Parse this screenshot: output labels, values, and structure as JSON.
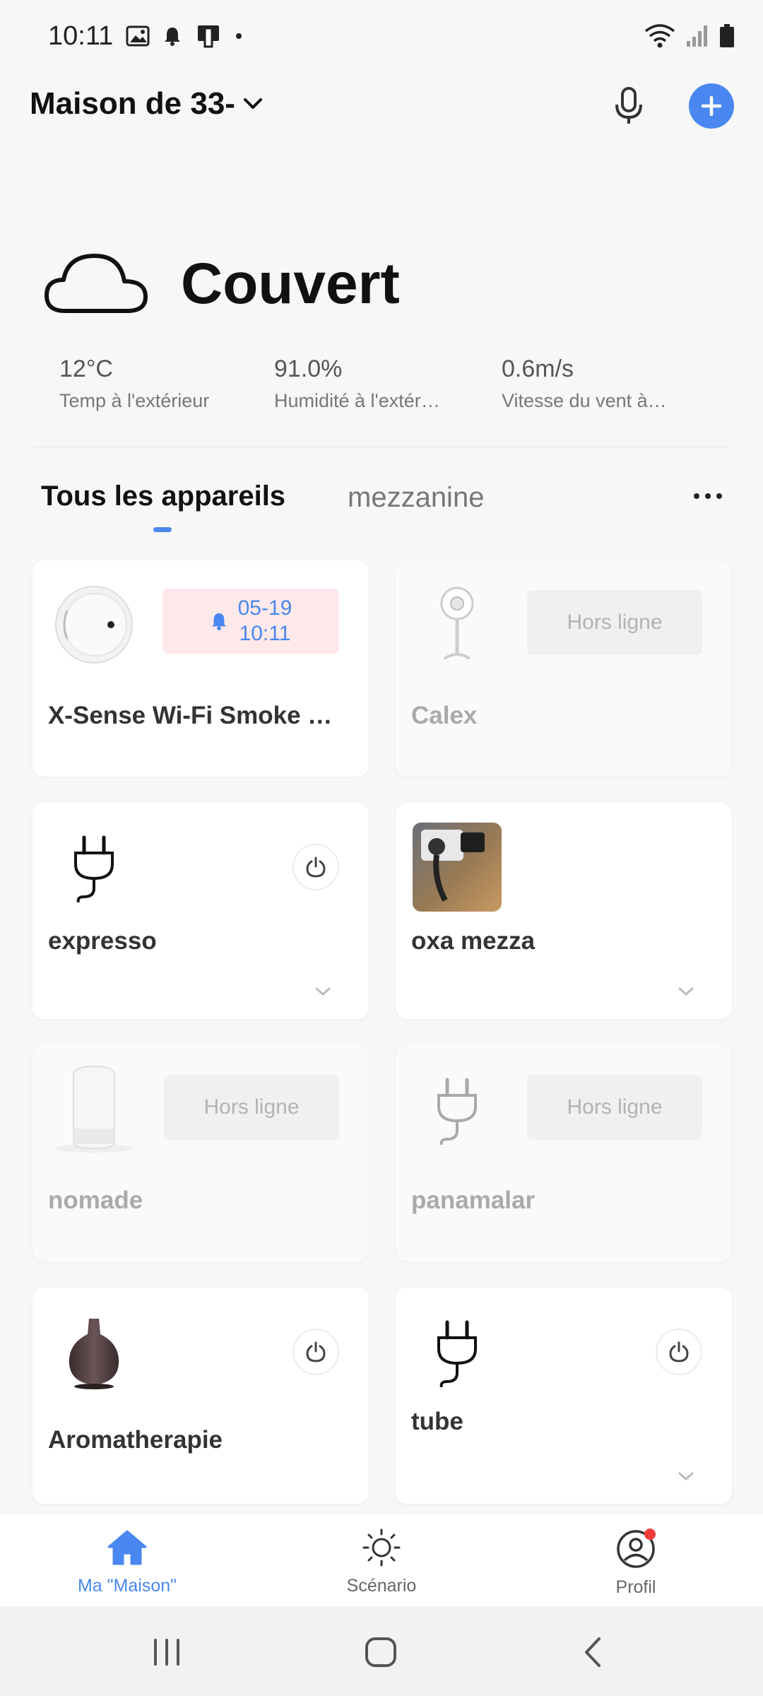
{
  "status_bar": {
    "time": "10:11"
  },
  "header": {
    "home_name": "Maison de 33-"
  },
  "weather": {
    "condition": "Couvert",
    "temp_value": "12°C",
    "temp_label": "Temp à l'extérieur",
    "humidity_value": "91.0%",
    "humidity_label": "Humidité à l'extér…",
    "wind_value": "0.6m/s",
    "wind_label": "Vitesse du vent à…"
  },
  "tabs": {
    "active": "Tous les appareils",
    "other": "mezzanine"
  },
  "devices": [
    {
      "name": "X-Sense Wi-Fi Smoke …",
      "alarm_date": "05-19",
      "alarm_time": "10:11"
    },
    {
      "name": "Calex",
      "status": "Hors ligne"
    },
    {
      "name": "expresso"
    },
    {
      "name": "oxa mezza"
    },
    {
      "name": "nomade",
      "status": "Hors ligne"
    },
    {
      "name": "panamalar",
      "status": "Hors ligne"
    },
    {
      "name": "Aromatherapie"
    },
    {
      "name": "tube"
    }
  ],
  "bottom_nav": [
    {
      "label": "Ma \"Maison\""
    },
    {
      "label": "Scénario"
    },
    {
      "label": "Profil"
    }
  ],
  "colors": {
    "accent": "#4a87f0",
    "alarm_bg": "#fde9ea",
    "badge_dot": "#f23c3c"
  }
}
